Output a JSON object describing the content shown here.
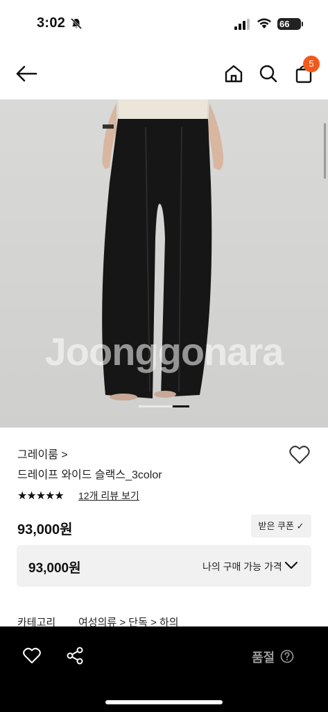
{
  "status": {
    "time": "3:02",
    "battery": "66"
  },
  "nav": {
    "cart_count": "5"
  },
  "image": {
    "watermark": "Joonggonara",
    "carousel_active_index": 1,
    "carousel_count": 2
  },
  "product": {
    "brand": "그레이룸 >",
    "name": "드레이프 와이드 슬랙스_3color",
    "rating_stars": "★★★★★",
    "review_link": "12개 리뷰 보기",
    "price": "93,000원",
    "coupon_button": "받은 쿠폰 ✓",
    "purchase_price": "93,000원",
    "purchase_label": "나의 구매 가능 가격"
  },
  "category": {
    "label": "카테고리",
    "path": "여성의류 > 단독 > 하의"
  },
  "bottom_bar": {
    "status": "품절"
  },
  "colors": {
    "badge": "#f25a1c",
    "bar": "#000000",
    "soldout": "#9a9a9a"
  }
}
